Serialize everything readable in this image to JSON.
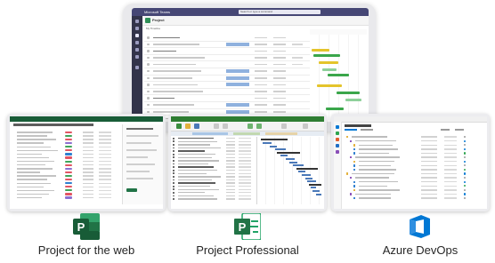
{
  "teams_window": {
    "app_bar_title": "Microsoft Teams",
    "search_placeholder": "Search or type a command",
    "tab_title": "Project",
    "breadcrumb": "My Timeline"
  },
  "products": [
    {
      "label": "Project for the web",
      "icon": "project-web-logo",
      "color": "#185c37"
    },
    {
      "label": "Project Professional",
      "icon": "project-professional-logo",
      "color": "#21a366"
    },
    {
      "label": "Azure DevOps",
      "icon": "azure-devops-logo",
      "color": "#0078d4"
    }
  ],
  "colors": {
    "project_green": "#217346",
    "teams_purple": "#464775",
    "gantt_green": "#3aa64a",
    "gantt_yellow": "#e4c42b",
    "azure_blue": "#0078d4"
  }
}
